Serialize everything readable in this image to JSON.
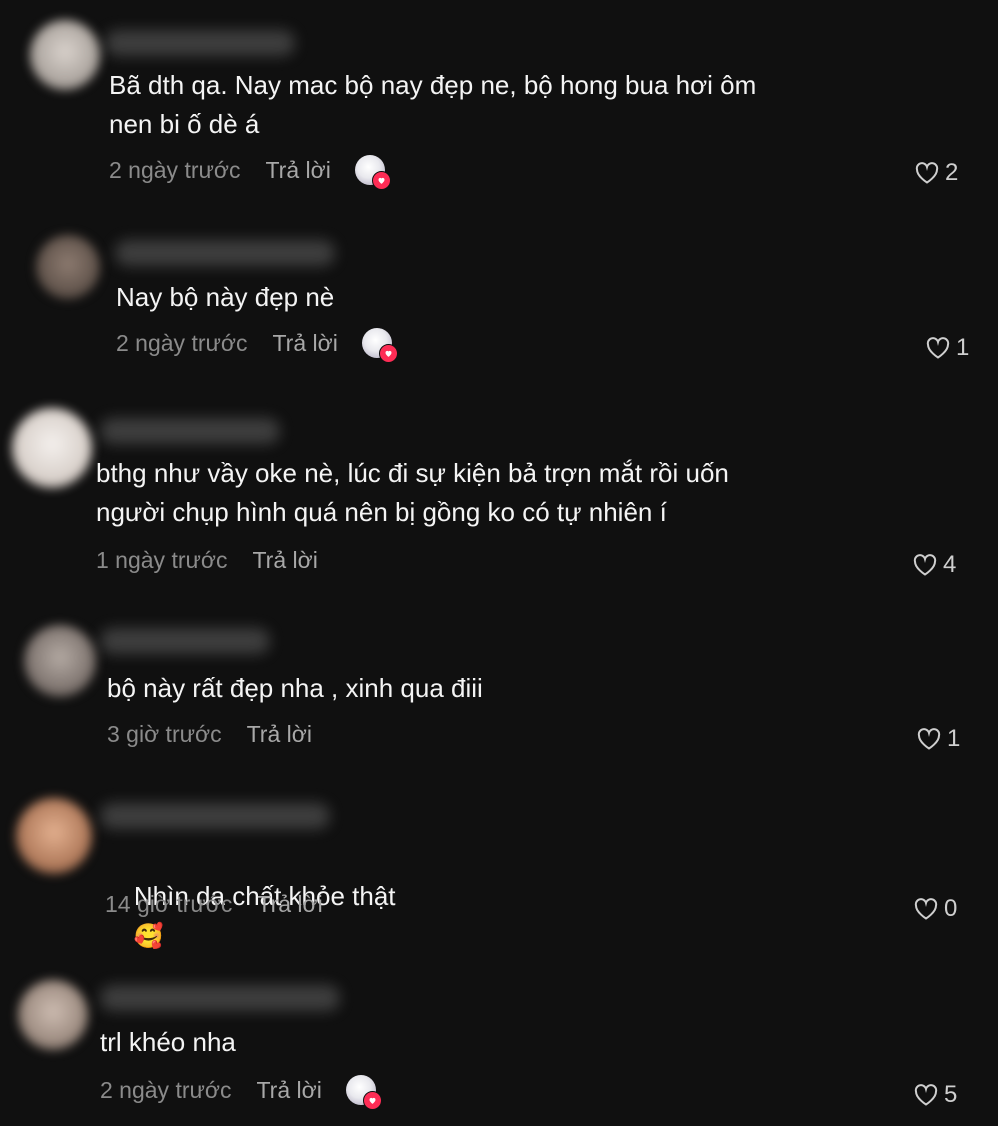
{
  "comments": [
    {
      "text": "Bã dth qa. Nay mac bộ nay đẹp ne, bộ hong bua hơi ôm\nnen bi ố dè á",
      "time": "2 ngày trước",
      "reply": "Trả lời",
      "likes": "2",
      "creator_liked": true
    },
    {
      "text": "Nay bộ này đẹp nè",
      "time": "2 ngày trước",
      "reply": "Trả lời",
      "likes": "1",
      "creator_liked": true
    },
    {
      "text": "bthg như vầy oke nè, lúc đi sự kiện bả trợn mắt rồi uốn\nngười chụp hình quá nên bị gồng ko có tự nhiên í",
      "time": "1 ngày trước",
      "reply": "Trả lời",
      "likes": "4",
      "creator_liked": false
    },
    {
      "text": "bộ này rất đẹp nha , xinh qua điii",
      "time": "3 giờ trước",
      "reply": "Trả lời",
      "likes": "1",
      "creator_liked": false
    },
    {
      "text": "Nhìn da chất khỏe thật",
      "emoji": "🥰",
      "time": "14 giờ trước",
      "reply": "Trả lời",
      "likes": "0",
      "creator_liked": false
    },
    {
      "text": "trl khéo nha",
      "time": "2 ngày trước",
      "reply": "Trả lời",
      "likes": "5",
      "creator_liked": true
    }
  ],
  "colors": {
    "background": "#101010",
    "text": "#f4f4f4",
    "meta": "#8b8b8b",
    "like_badge": "#fe2c55"
  },
  "icons": {
    "like": "heart-outline-icon",
    "creator_like": "creator-heart-badge-icon"
  }
}
